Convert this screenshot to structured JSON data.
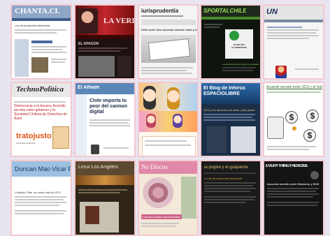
{
  "tiles": [
    {
      "title": "CHANTA.CL",
      "sub": "Ley de propiedad intelectual"
    },
    {
      "title": "LA VERDAD",
      "sub": "EL APAGON"
    },
    {
      "title": "iurisprudentia",
      "sub": "Chile sufre otro acuerdo secreto: todo y todo para algunos"
    },
    {
      "title": "SPORTALCHILE",
      "sub": "Acuerdo secreto por la ley de propiedad",
      "badge": "YO NO SOY CLANDESTINO"
    },
    {
      "title": "UN",
      "sub": ""
    },
    {
      "title": "TechnoPolitica",
      "sub": "Democracia a la basura: Acuerdo secreto entre gobierno y la Sociedad Chilena de Derechos de Autor",
      "logo": "tratojusto",
      "logo_sub": "propiedad intelectual"
    },
    {
      "title": "El Alfaale",
      "sub": "Chile importa lo peor del cannon digital"
    },
    {
      "title": "",
      "sub": ""
    },
    {
      "title": "El Blog de Inforus ESPACIOLIBRE",
      "sub": "SCD y los derechos de autor ¿todo justo?"
    },
    {
      "title": "Acuerdo secreto entre SCD y el Gobierno",
      "sub": "",
      "signs": [
        "$",
        "$",
        "$"
      ]
    },
    {
      "title": "Duncan Mac-Vicar P.",
      "sub": "Cuidado Chile, se viene otra ley SCD"
    },
    {
      "title": "Linux Los Angeles",
      "sub": ""
    },
    {
      "title": "No Discos",
      "sub": "Cuando vuestra nueva libertad"
    },
    {
      "title": "la pogilla y el guapache",
      "sub": "La ley de propiedad intelectual"
    },
    {
      "title": "EVERYTHINGTHENOISE",
      "sub": "Acuerdo secreto entre Gobierno y SCD"
    }
  ]
}
